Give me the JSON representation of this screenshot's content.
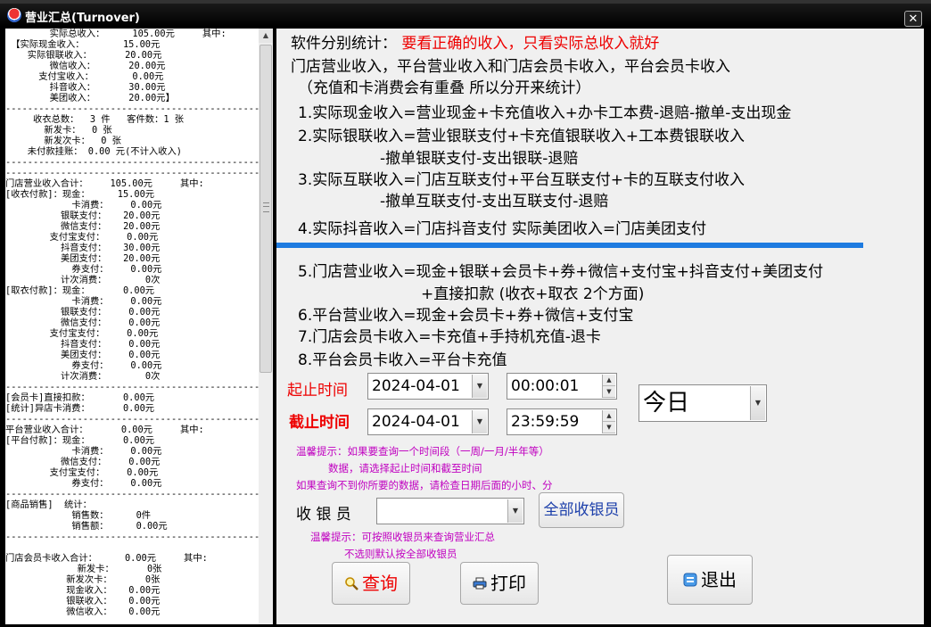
{
  "window": {
    "title": "营业汇总(Turnover)",
    "close_glyph": "✕"
  },
  "report_lines": [
    "        实际总收入：     105.00元     其中:",
    " 【实际现金收入：       15.00元",
    "    实际银联收入：      20.00元",
    "        微信收入：      20.00元",
    "      支付宝收入：       0.00元",
    "        抖音收入：      30.00元",
    "        美团收入：      20.00元】",
    "----------------------------------------------",
    "     收衣总数：  3 件   客件数：1 张",
    "       新发卡：  0 张",
    "       新发次卡：  0 张",
    "    未付款挂账： 0.00 元(不计入收入)",
    "----------------------------------------------",
    "----------------------------------------------",
    "门店营业收入合计：    105.00元     其中:",
    "[收衣付款]：现金：     15.00元",
    "            卡消费：    0.00元",
    "          银联支付：   20.00元",
    "          微信支付：   20.00元",
    "        支付宝支付：    0.00元",
    "          抖音支付：   30.00元",
    "          美团支付：   20.00元",
    "            券支付：    0.00元",
    "          计次消费：       0次",
    "[取衣付款]：现金：      0.00元",
    "            卡消费：    0.00元",
    "          银联支付：    0.00元",
    "          微信支付：    0.00元",
    "        支付宝支付：    0.00元",
    "          抖音支付：    0.00元",
    "          美团支付：    0.00元",
    "            券支付：    0.00元",
    "          计次消费：       0次",
    "----------------------------------------------",
    "[会员卡]直接扣款：      0.00元",
    "[统计]异店卡消费：      0.00元",
    "----------------------------------------------",
    "平台营业收入合计：      0.00元     其中:",
    "[平台付款]：现金：      0.00元",
    "            卡消费：    0.00元",
    "          微信支付：    0.00元",
    "        支付宝支付：    0.00元",
    "            券支付：    0.00元",
    "----------------------------------------------",
    "[商品销售]  统计：",
    "            销售数：     0件",
    "            销售额：     0.00元",
    "----------------------------------------------",
    "",
    "门店会员卡收入合计：     0.00元     其中:",
    "             新发卡：      0张",
    "           新发次卡：      0张",
    "           现金收入：   0.00元",
    "           银联收入：   0.00元",
    "           微信收入：   0.00元"
  ],
  "notes": {
    "header_prefix": "软件分别统计：",
    "header_highlight": "要看正确的收入，只看实际总收入就好",
    "line2": "门店营业收入，平台营业收入和门店会员卡收入，平台会员卡收入",
    "line3": "（充值和卡消费会有重叠 所以分开来统计）",
    "f1": "1.实际现金收入=营业现金+卡充值收入+办卡工本费-退赔-撤单-支出现金",
    "f2a": "2.实际银联收入=营业银联支付+卡充值银联收入+工本费银联收入",
    "f2b": "-撤单银联支付-支出银联-退赔",
    "f3a": "3.实际互联收入=门店互联支付+平台互联支付+卡的互联支付收入",
    "f3b": "-撤单互联支付-支出互联支付-退赔",
    "f4": "4.实际抖音收入=门店抖音支付   实际美团收入=门店美团支付",
    "f5a": "5.门店营业收入=现金+银联+会员卡+券+微信+支付宝+抖音支付+美团支付",
    "f5b": "+直接扣款        (收衣+取衣 2个方面)",
    "f6": "6.平台营业收入=现金+会员卡+券+微信+支付宝",
    "f7": "7.门店会员卡收入=卡充值+手持机充值-退卡",
    "f8": "8.平台会员卡收入=平台卡充值"
  },
  "form": {
    "start_label": "起止时间",
    "end_label": "截止时间",
    "start_date": "2024-04-01",
    "start_time": "00:00:01",
    "end_date": "2024-04-01",
    "end_time": "23:59:59",
    "period": "今日",
    "tip1": "温馨提示：如果要查询一个时间段（一周/一月/半年等）",
    "tip2": "数据，请选择起止时间和截至时间",
    "tip3": "如果查询不到你所要的数据，请检查日期后面的小时、分",
    "cashier_label": "收 银 员",
    "cashier_value": "",
    "all_cashiers": "全部收银员",
    "tip4": "温馨提示：可按照收银员来查询营业汇总",
    "tip5": "不选则默认按全部收银员"
  },
  "buttons": {
    "query": "查询",
    "print": "打印",
    "exit": "退出"
  }
}
